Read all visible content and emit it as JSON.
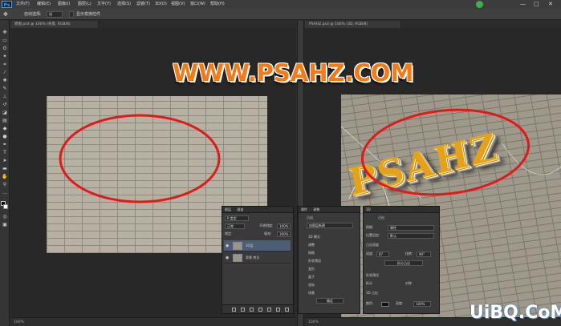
{
  "menubar": {
    "logo": "Ps",
    "items": [
      "文件(F)",
      "编辑(E)",
      "图像(I)",
      "图层(L)",
      "文字(Y)",
      "选择(S)",
      "滤镜(T)",
      "3D(D)",
      "视图(V)",
      "窗口(W)",
      "帮助(H)"
    ],
    "window_controls": [
      "—",
      "□",
      "✕"
    ]
  },
  "optbar": {
    "mode_label": "自动选择:",
    "mode_value": "组",
    "transform_label": "显示变换控件"
  },
  "doc_tabs": {
    "left": "原图.psd @ 100% (背景, RGB/8)",
    "right": "PSAHZ.psd @ 100% (3D, RGB/8)"
  },
  "watermark": "WWW.PSAHZ.COM",
  "canvas_right_text": "PSAHZ",
  "status": {
    "left_zoom": "100%",
    "right_zoom": "100%",
    "right_zoom2": "100%"
  },
  "layers_panel": {
    "tabs": [
      "图层",
      "通道"
    ],
    "kind": "P 类型",
    "blend": "正常",
    "opacity_label": "不透明度:",
    "opacity": "100%",
    "lock_label": "锁定:",
    "fill_label": "填充:",
    "fill": "100%",
    "layers": [
      {
        "name": "3D层"
      },
      {
        "name": "背景 拷贝"
      }
    ]
  },
  "props_panel": {
    "tabs": [
      "属性",
      "调整"
    ],
    "title": "凸出",
    "rows": [
      "3D 模式",
      "调整",
      "网格",
      "形状预设",
      "变形",
      "盖子",
      "坐标",
      "场景"
    ],
    "select1": "由图层新建",
    "button": "确定"
  },
  "mat_panel": {
    "tab": "3D",
    "title": "凸出",
    "label1": "网格:",
    "val1": "属性",
    "label2": "位置设定:",
    "val2": "默认",
    "section": "凸出深度",
    "depth_label": "深度:",
    "depth": "87",
    "angle_label": "扭转:",
    "angle": "90°",
    "btn": "拆分凸出",
    "section2": "形状预设",
    "check1": "拆分",
    "check2": "对称",
    "check3": "3D 凸出",
    "color_label": "颜色:",
    "depth2_label": "深度:",
    "depth2": "100%"
  },
  "site_logo": "UiBQ.CoM",
  "colors": {
    "annotation": "#e01a1a",
    "watermark": "#f47b16",
    "gold": "#e3a21a"
  }
}
